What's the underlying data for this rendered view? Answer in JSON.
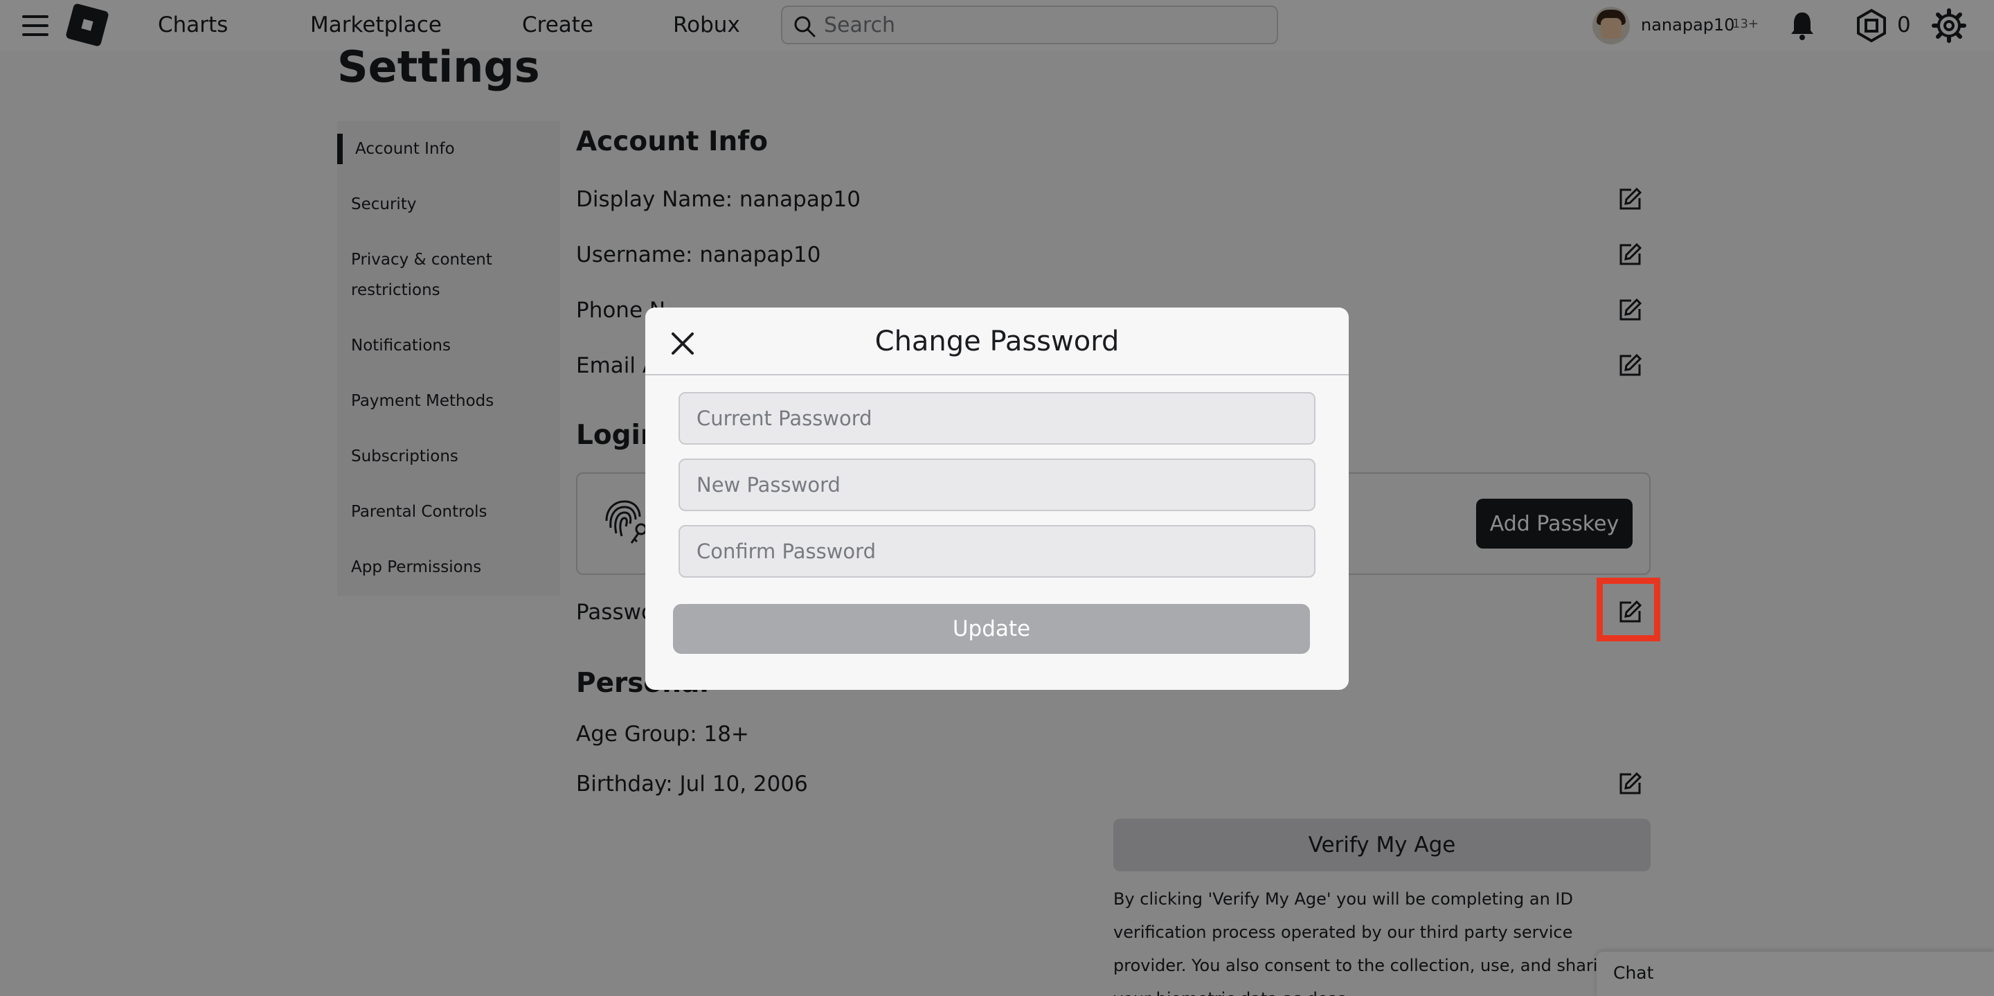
{
  "nav": {
    "links": [
      "Charts",
      "Marketplace",
      "Create",
      "Robux"
    ],
    "search_placeholder": "Search",
    "username": "nanapap10",
    "age_badge": "13+",
    "robux_balance": "0"
  },
  "page": {
    "title": "Settings"
  },
  "sidebar": {
    "items": [
      {
        "label": "Account Info",
        "active": true
      },
      {
        "label": "Security"
      },
      {
        "label": "Privacy & content",
        "label2": "restrictions"
      },
      {
        "label": "Notifications"
      },
      {
        "label": "Payment Methods"
      },
      {
        "label": "Subscriptions"
      },
      {
        "label": "Parental Controls"
      },
      {
        "label": "App Permissions"
      }
    ]
  },
  "account_info": {
    "heading": "Account Info",
    "display_name": "Display Name: nanapap10",
    "username": "Username: nanapap10",
    "phone_partial": "Phone N",
    "email_partial": "Email A"
  },
  "login": {
    "heading_partial": "Login",
    "add_passkey": "Add Passkey",
    "password_partial": "Passwo"
  },
  "personal": {
    "heading_partial": "Personal",
    "age_group": "Age Group: 18+",
    "birthday": "Birthday: Jul 10, 2006",
    "verify_button": "Verify My Age",
    "disclaimer": "By clicking 'Verify My Age' you will be completing an ID verification process operated by our third party service provider. You also consent to the collection, use, and sharing of your biometric data as desc"
  },
  "chat": {
    "label": "Chat"
  },
  "modal": {
    "title": "Change Password",
    "current_placeholder": "Current Password",
    "new_placeholder": "New Password",
    "confirm_placeholder": "Confirm Password",
    "update_label": "Update"
  },
  "colors": {
    "highlight": "#e8351f",
    "primary_button": "#1b1c1f",
    "disabled_button": "#a9aaae"
  }
}
